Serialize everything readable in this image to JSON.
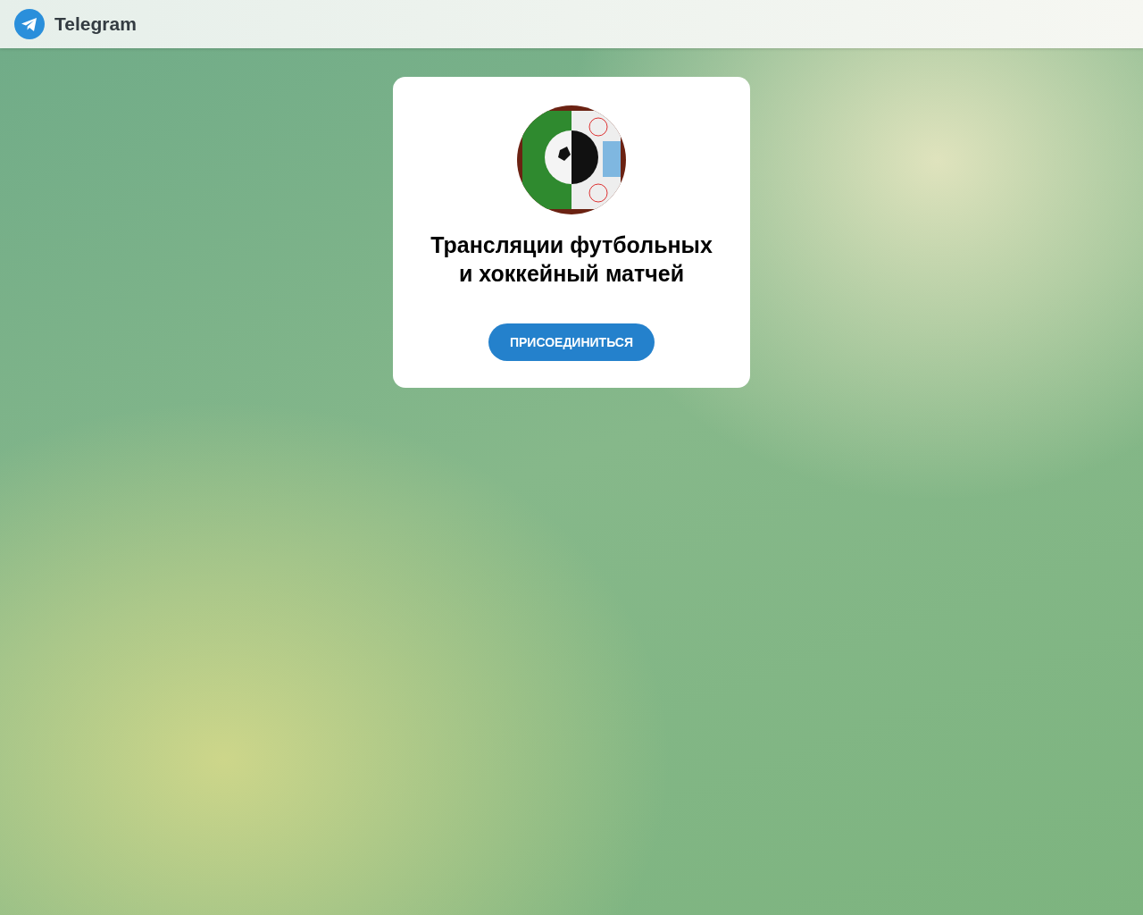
{
  "header": {
    "app_name": "Telegram"
  },
  "card": {
    "title": "Трансляции футбольных\nи хоккейный матчей",
    "button": "ПРИСОЕДИНИТЬСЯ"
  }
}
